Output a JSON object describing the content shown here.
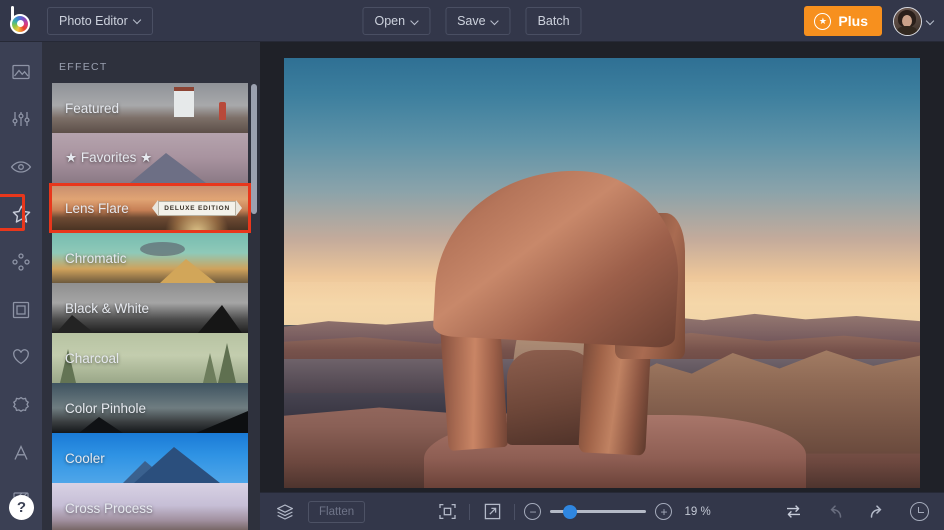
{
  "app": {
    "logo_name": "bonanza-color-wheel-logo",
    "menu_label": "Photo Editor"
  },
  "topbar": {
    "open_label": "Open",
    "save_label": "Save",
    "batch_label": "Batch",
    "plus_label": "Plus",
    "plus_color": "#f7901e",
    "avatar_name": "user-avatar"
  },
  "rail": {
    "items": [
      {
        "name": "image-icon",
        "title": "Image"
      },
      {
        "name": "adjust-sliders-icon",
        "title": "Adjust"
      },
      {
        "name": "eye-effects-icon",
        "title": "Effects preview"
      },
      {
        "name": "star-effect-icon",
        "title": "Effect",
        "selected": true
      },
      {
        "name": "overlay-dots-icon",
        "title": "Overlays"
      },
      {
        "name": "frame-icon",
        "title": "Frames"
      },
      {
        "name": "heart-icon",
        "title": "Favorites"
      },
      {
        "name": "sticker-icon",
        "title": "Stickers"
      },
      {
        "name": "text-icon",
        "title": "Text"
      },
      {
        "name": "texture-icon",
        "title": "Texture"
      }
    ],
    "help_label": "?",
    "selection_color": "#e8371c"
  },
  "effects": {
    "header": "EFFECT",
    "items": [
      {
        "label": "Featured",
        "thumb": "t-featured",
        "selected": false,
        "badge": null
      },
      {
        "label": "★ Favorites ★",
        "thumb": "t-fav",
        "selected": false,
        "badge": null
      },
      {
        "label": "Lens Flare",
        "thumb": "t-lens",
        "selected": true,
        "badge": "DELUXE EDITION"
      },
      {
        "label": "Chromatic",
        "thumb": "t-chrom",
        "selected": false,
        "badge": null
      },
      {
        "label": "Black & White",
        "thumb": "t-bw",
        "selected": false,
        "badge": null
      },
      {
        "label": "Charcoal",
        "thumb": "t-char",
        "selected": false,
        "badge": null
      },
      {
        "label": "Color Pinhole",
        "thumb": "t-pin",
        "selected": false,
        "badge": null
      },
      {
        "label": "Cooler",
        "thumb": "t-cool",
        "selected": false,
        "badge": null
      },
      {
        "label": "Cross Process",
        "thumb": "t-cross",
        "selected": false,
        "badge": null
      }
    ]
  },
  "canvas": {
    "photo_description": "Delicate Arch sandstone formation at sunset, Arches National Park"
  },
  "bottombar": {
    "layers_icon": "layers-icon",
    "flatten_label": "Flatten",
    "fit_icon": "fit-to-screen-icon",
    "expand_icon": "fullscreen-expand-icon",
    "zoom_out_label": "−",
    "zoom_in_label": "+",
    "zoom_value": "19 %",
    "zoom_percent": 19,
    "slider_position_percent": 20,
    "compare_icon": "compare-swap-icon",
    "undo_icon": "undo-icon",
    "redo_icon": "redo-icon",
    "history_icon": "history-clock-icon"
  }
}
